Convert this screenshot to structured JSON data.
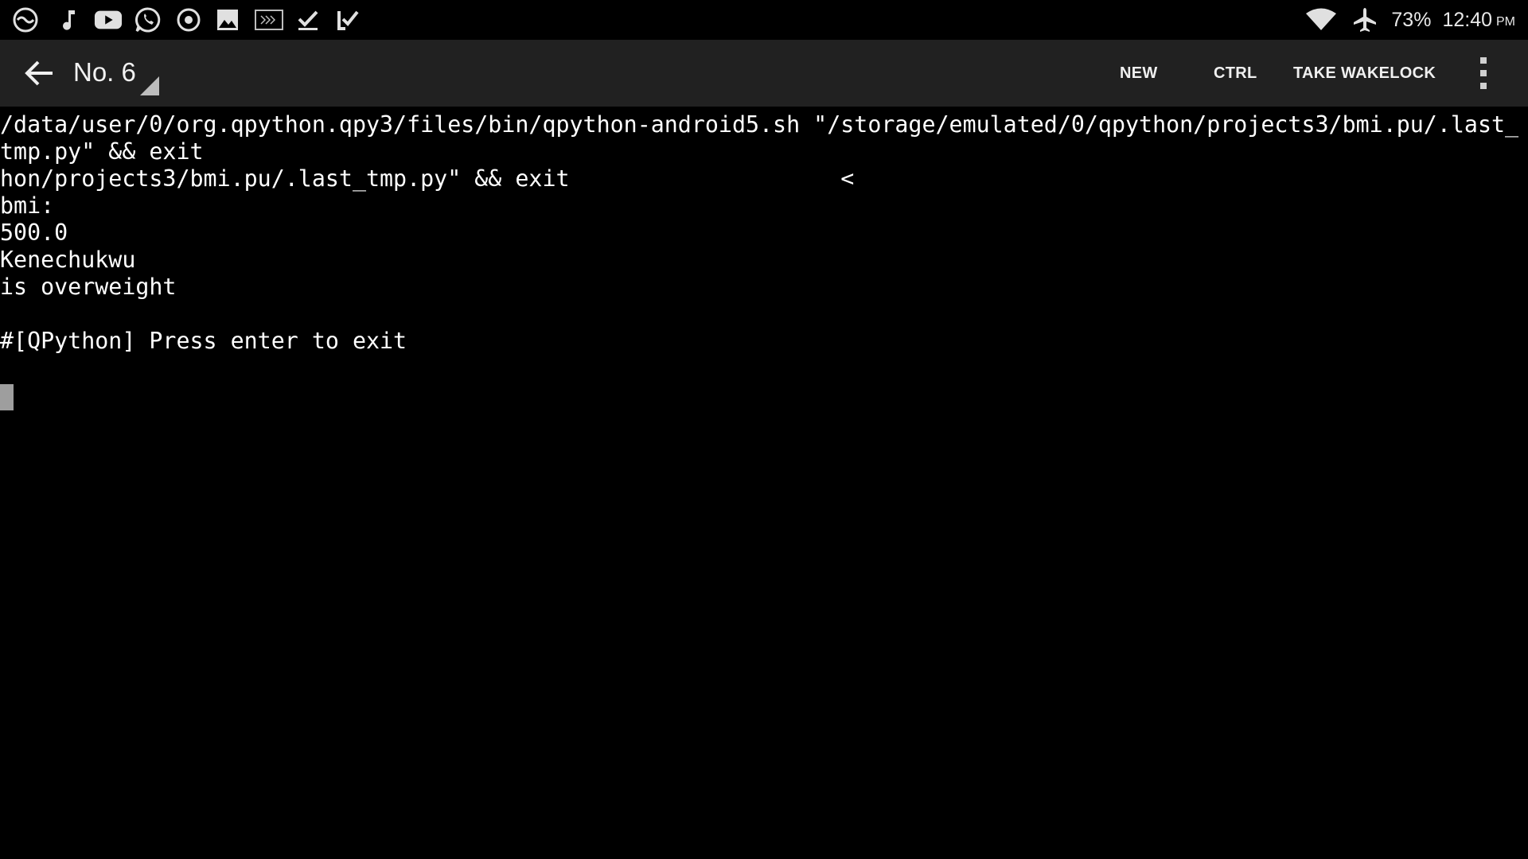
{
  "status_bar": {
    "left_icons": [
      "nbx-app-icon",
      "music-note-icon",
      "youtube-icon",
      "whatsapp-icon",
      "record-icon",
      "image-icon",
      "keyboard-icon",
      "checkmark-icon",
      "task-done-icon"
    ],
    "right_icons": [
      "wifi-icon",
      "airplane-mode-icon"
    ],
    "battery": "73%",
    "time": "12:40",
    "ampm": "PM"
  },
  "action_bar": {
    "back_icon": "arrow-back-icon",
    "window_title": "No. 6",
    "actions": {
      "new": "NEW",
      "ctrl": "CTRL",
      "take_wakelock": "TAKE WAKELOCK"
    },
    "overflow_icon": "more-vert-icon"
  },
  "terminal": {
    "lines": [
      "/data/user/0/org.qpython.qpy3/files/bin/qpython-android5.sh \"/storage/emulated/0/qpython/projects3/bmi.pu/.last_",
      "tmp.py\" && exit",
      "hon/projects3/bmi.pu/.last_tmp.py\" && exit                    <",
      "bmi:",
      "500.0",
      "Kenechukwu",
      "is overweight",
      "",
      "#[QPython] Press enter to exit"
    ]
  },
  "colors": {
    "background": "#000000",
    "action_bar": "#212121",
    "text": "#ffffff",
    "cursor": "#9e9e9e"
  }
}
